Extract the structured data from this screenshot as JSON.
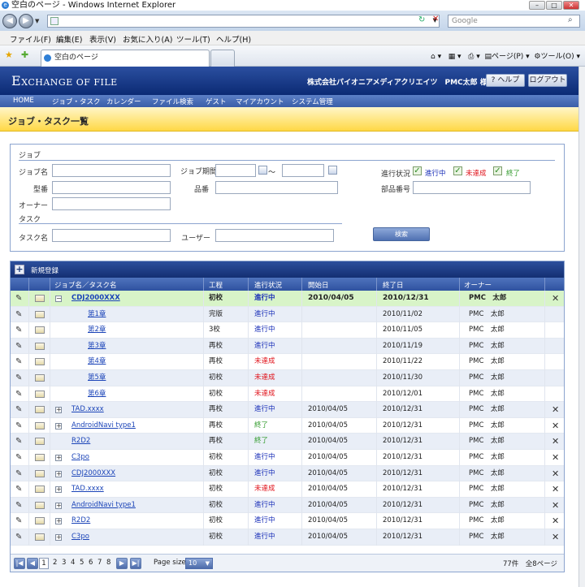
{
  "browser": {
    "window_title": "空白のページ - Windows Internet Explorer",
    "search_placeholder": "Google",
    "menu": [
      "ファイル(F)",
      "編集(E)",
      "表示(V)",
      "お気に入り(A)",
      "ツール(T)",
      "ヘルプ(H)"
    ],
    "tab_label": "空白のページ",
    "cmd_page": "ページ(P)",
    "cmd_tools": "ツール(O)"
  },
  "app": {
    "logo_main": "E",
    "logo_rest": "XCHANGE OF FILE",
    "company": "株式会社パイオニアメディアクリエイツ　PMC太郎 様",
    "help": "ヘルプ",
    "logout": "ログアウト",
    "nav": [
      "HOME",
      "ジョブ・タスク",
      "カレンダー",
      "ファイル検索",
      "ゲスト",
      "マイアカウント",
      "システム管理"
    ],
    "page_title": "ジョブ・タスク一覧"
  },
  "search": {
    "job_section": "ジョブ",
    "task_section": "タスク",
    "job_name": "ジョブ名",
    "job_period": "ジョブ期間",
    "period_sep": "～",
    "model": "型番",
    "product": "品番",
    "owner": "オーナー",
    "progress_label": "進行状況",
    "part_number": "部品番号",
    "status_options": [
      {
        "label": "進行中",
        "color": "#1a2fb8"
      },
      {
        "label": "未達成",
        "color": "#e0121a"
      },
      {
        "label": "終了",
        "color": "#2f9a2a"
      }
    ],
    "task_name": "タスク名",
    "user": "ユーザー",
    "search_button": "検索"
  },
  "grid": {
    "new_label": "新規登録",
    "headers": [
      "ジョブ名／タスク名",
      "工程",
      "進行状況",
      "開始日",
      "終了日",
      "オーナー"
    ],
    "rows": [
      {
        "name": "CDJ2000XXX",
        "kind": "job",
        "expanded": true,
        "process": "初校",
        "status": "進行中",
        "status_type": "prog",
        "start": "2010/04/05",
        "end": "2010/12/31",
        "owner": "PMC　太郎",
        "bold": true,
        "delete": true
      },
      {
        "name": "第1章",
        "kind": "task",
        "process": "完版",
        "status": "進行中",
        "status_type": "prog",
        "start": "",
        "end": "2010/11/02",
        "owner": "PMC　太郎"
      },
      {
        "name": "第2章",
        "kind": "task",
        "process": "3校",
        "status": "進行中",
        "status_type": "prog",
        "start": "",
        "end": "2010/11/05",
        "owner": "PMC　太郎"
      },
      {
        "name": "第3章",
        "kind": "task",
        "process": "再校",
        "status": "進行中",
        "status_type": "prog",
        "start": "",
        "end": "2010/11/19",
        "owner": "PMC　太郎"
      },
      {
        "name": "第4章",
        "kind": "task",
        "process": "再校",
        "status": "未達成",
        "status_type": "ng",
        "start": "",
        "end": "2010/11/22",
        "owner": "PMC　太郎"
      },
      {
        "name": "第5章",
        "kind": "task",
        "process": "初校",
        "status": "未達成",
        "status_type": "ng",
        "start": "",
        "end": "2010/11/30",
        "owner": "PMC　太郎"
      },
      {
        "name": "第6章",
        "kind": "task",
        "process": "初校",
        "status": "未達成",
        "status_type": "ng",
        "start": "",
        "end": "2010/12/01",
        "owner": "PMC　太郎"
      },
      {
        "name": "TAD.xxxx",
        "kind": "job",
        "expanded": false,
        "process": "再校",
        "status": "進行中",
        "status_type": "prog",
        "start": "2010/04/05",
        "end": "2010/12/31",
        "owner": "PMC　太郎",
        "delete": true
      },
      {
        "name": "AndroidNavi type1",
        "kind": "job",
        "expanded": false,
        "process": "再校",
        "status": "終了",
        "status_type": "done",
        "start": "2010/04/05",
        "end": "2010/12/31",
        "owner": "PMC　太郎",
        "delete": true
      },
      {
        "name": "R2D2",
        "kind": "job",
        "noexp": true,
        "process": "再校",
        "status": "終了",
        "status_type": "done",
        "start": "2010/04/05",
        "end": "2010/12/31",
        "owner": "PMC　太郎",
        "delete": true
      },
      {
        "name": "C3po",
        "kind": "job",
        "expanded": false,
        "process": "初校",
        "status": "進行中",
        "status_type": "prog",
        "start": "2010/04/05",
        "end": "2010/12/31",
        "owner": "PMC　太郎",
        "delete": true
      },
      {
        "name": "CDJ2000XXX",
        "kind": "job",
        "expanded": false,
        "process": "初校",
        "status": "進行中",
        "status_type": "prog",
        "start": "2010/04/05",
        "end": "2010/12/31",
        "owner": "PMC　太郎",
        "delete": true
      },
      {
        "name": "TAD.xxxx",
        "kind": "job",
        "expanded": false,
        "process": "初校",
        "status": "未達成",
        "status_type": "ng",
        "start": "2010/04/05",
        "end": "2010/12/31",
        "owner": "PMC　太郎",
        "delete": true
      },
      {
        "name": "AndroidNavi type1",
        "kind": "job",
        "expanded": false,
        "process": "初校",
        "status": "進行中",
        "status_type": "prog",
        "start": "2010/04/05",
        "end": "2010/12/31",
        "owner": "PMC　太郎",
        "delete": true
      },
      {
        "name": "R2D2",
        "kind": "job",
        "expanded": false,
        "process": "初校",
        "status": "進行中",
        "status_type": "prog",
        "start": "2010/04/05",
        "end": "2010/12/31",
        "owner": "PMC　太郎",
        "delete": true
      },
      {
        "name": "C3po",
        "kind": "job",
        "expanded": false,
        "process": "初校",
        "status": "進行中",
        "status_type": "prog",
        "start": "2010/04/05",
        "end": "2010/12/31",
        "owner": "PMC　太郎",
        "delete": true
      }
    ],
    "pager": {
      "pages": [
        "1",
        "2",
        "3",
        "4",
        "5",
        "6",
        "7",
        "8"
      ],
      "current": "1",
      "page_size_label": "Page size:",
      "page_size": "10",
      "count": "77件　全8ページ"
    }
  }
}
